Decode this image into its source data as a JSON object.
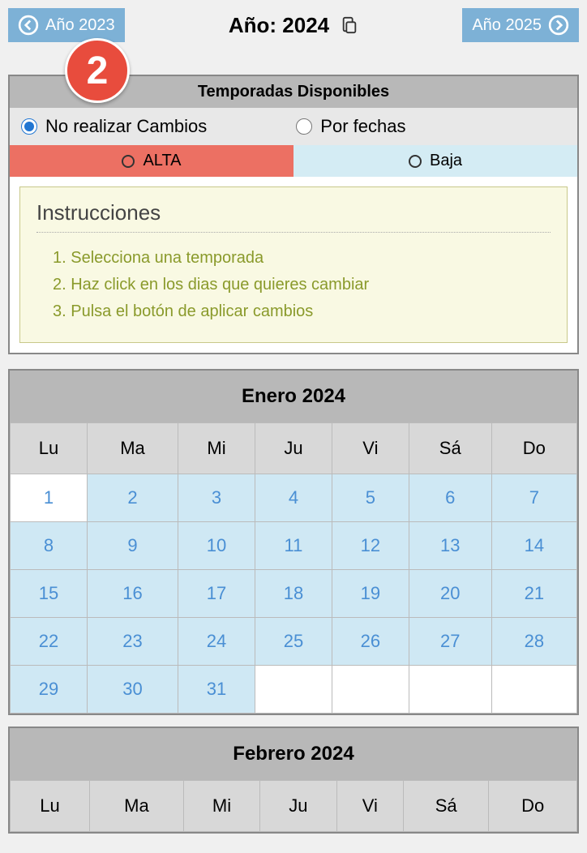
{
  "nav": {
    "prev": "Año 2023",
    "title": "Año: 2024",
    "next": "Año 2025"
  },
  "badge": "2",
  "panel": {
    "header": "Temporadas Disponibles",
    "radio1": "No realizar Cambios",
    "radio2": "Por fechas",
    "alta": "ALTA",
    "baja": "Baja"
  },
  "instructions": {
    "title": "Instrucciones",
    "item1": "1. Selecciona una temporada",
    "item2": "2. Haz click en los dias que quieres cambiar",
    "item3": "3. Pulsa el botón de aplicar cambios"
  },
  "cal1": {
    "title": "Enero 2024",
    "days": {
      "lu": "Lu",
      "ma": "Ma",
      "mi": "Mi",
      "ju": "Ju",
      "vi": "Vi",
      "sa": "Sá",
      "do": "Do"
    },
    "d1": "1",
    "d2": "2",
    "d3": "3",
    "d4": "4",
    "d5": "5",
    "d6": "6",
    "d7": "7",
    "d8": "8",
    "d9": "9",
    "d10": "10",
    "d11": "11",
    "d12": "12",
    "d13": "13",
    "d14": "14",
    "d15": "15",
    "d16": "16",
    "d17": "17",
    "d18": "18",
    "d19": "19",
    "d20": "20",
    "d21": "21",
    "d22": "22",
    "d23": "23",
    "d24": "24",
    "d25": "25",
    "d26": "26",
    "d27": "27",
    "d28": "28",
    "d29": "29",
    "d30": "30",
    "d31": "31"
  },
  "cal2": {
    "title": "Febrero 2024",
    "days": {
      "lu": "Lu",
      "ma": "Ma",
      "mi": "Mi",
      "ju": "Ju",
      "vi": "Vi",
      "sa": "Sá",
      "do": "Do"
    }
  }
}
